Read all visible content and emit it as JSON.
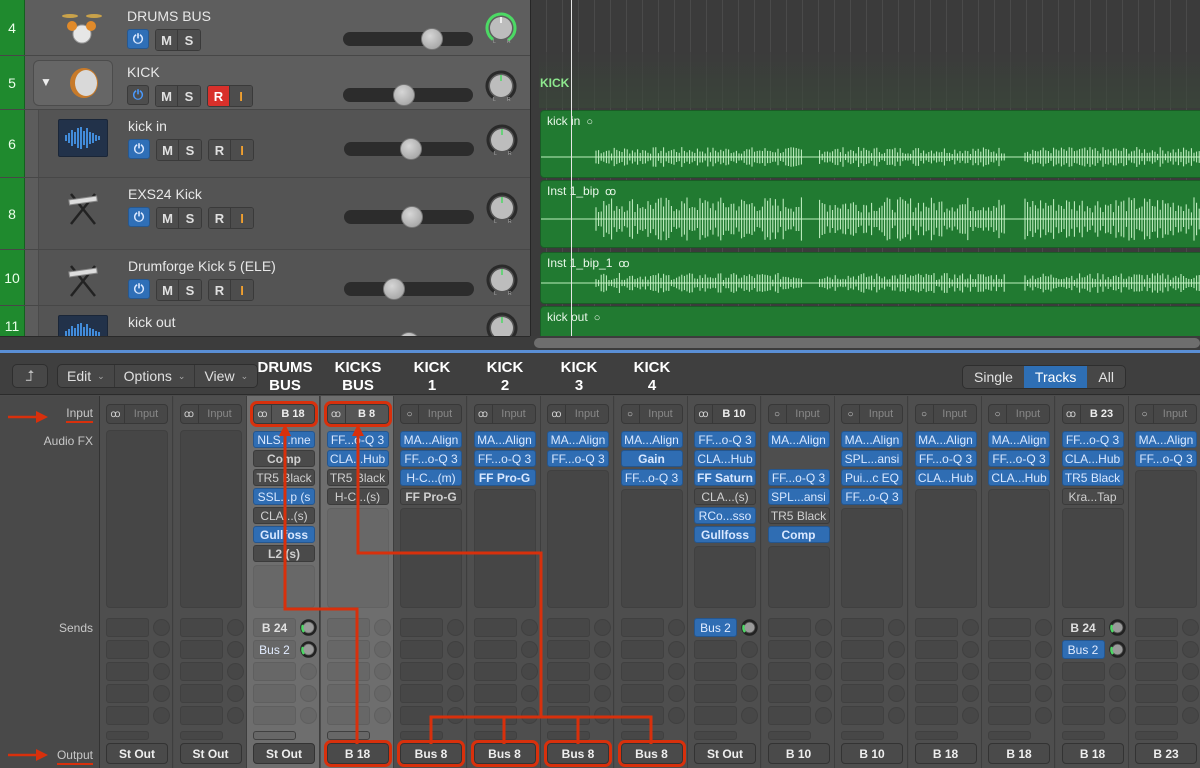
{
  "tracks": [
    {
      "number": "4",
      "name": "DRUMS BUS",
      "icon": "drum-kit-icon",
      "kind": "bus",
      "power_on": true,
      "buttons": [
        "M",
        "S"
      ],
      "record": null,
      "fader": 0.72,
      "pan_active": true
    },
    {
      "number": "5",
      "name": "KICK",
      "icon": "kick-drum-icon",
      "kind": "folder",
      "power_on": false,
      "buttons": [
        "M",
        "S"
      ],
      "record": {
        "r": "R",
        "i": "I",
        "armed": true
      },
      "fader": 0.46,
      "pan_active": false
    },
    {
      "number": "6",
      "name": "kick in",
      "icon": "audio-waveform-icon",
      "kind": "child",
      "power_on": true,
      "buttons": [
        "M",
        "S"
      ],
      "record": {
        "r": "R",
        "i": "I",
        "armed": false
      },
      "fader": 0.52,
      "pan_active": false
    },
    {
      "number": "8",
      "name": "EXS24 Kick",
      "icon": "keyboard-stand-icon",
      "kind": "child",
      "power_on": true,
      "buttons": [
        "M",
        "S"
      ],
      "record": {
        "r": "R",
        "i": "I",
        "armed": false
      },
      "fader": 0.53,
      "pan_active": false
    },
    {
      "number": "10",
      "name": "Drumforge Kick 5 (ELE)",
      "icon": "keyboard-stand-icon",
      "kind": "child",
      "power_on": true,
      "buttons": [
        "M",
        "S"
      ],
      "record": {
        "r": "R",
        "i": "I",
        "armed": false
      },
      "fader": 0.36,
      "pan_active": false
    },
    {
      "number": "11",
      "name": "kick out",
      "icon": "audio-waveform-icon",
      "kind": "child",
      "power_on": true,
      "buttons": [
        "M",
        "S"
      ],
      "record": null,
      "fader": 0.5,
      "pan_active": false
    }
  ],
  "arrange": {
    "folder_label": "KICK",
    "regions": [
      {
        "name": "kick in",
        "loop_icon": "○",
        "channels": "mono"
      },
      {
        "name": "Inst 1_bip",
        "loop_icon": "ꝏ",
        "channels": "stereo"
      },
      {
        "name": "Inst 1_bip_1",
        "loop_icon": "ꝏ",
        "channels": "stereo"
      },
      {
        "name": "kick out",
        "loop_icon": "○",
        "channels": "mono"
      }
    ]
  },
  "mixer": {
    "toolbar": {
      "back_icon": "⮥",
      "menus": [
        "Edit",
        "Options",
        "View"
      ],
      "view_modes": [
        "Single",
        "Tracks",
        "All"
      ],
      "active_view": "Tracks"
    },
    "row_labels": {
      "input": "Input",
      "audio_fx": "Audio FX",
      "sends": "Sends",
      "output": "Output"
    },
    "annotations": [
      "DRUMS BUS",
      "KICKS BUS",
      "KICK 1",
      "KICK 2",
      "KICK 3",
      "KICK 4"
    ],
    "strips": [
      {
        "input": {
          "fmt": "ꝏ",
          "value": "Input",
          "set": false
        },
        "fx": [],
        "sends": [],
        "output": "St Out"
      },
      {
        "input": {
          "fmt": "ꝏ",
          "value": "Input",
          "set": false
        },
        "fx": [],
        "sends": [],
        "output": "St Out"
      },
      {
        "input": {
          "fmt": "ꝏ",
          "value": "B 18",
          "set": true,
          "boxed": true
        },
        "highlight": true,
        "fx": [
          {
            "n": "NLS...nne",
            "on": true
          },
          {
            "n": "Comp",
            "on": false,
            "bold": true
          },
          {
            "n": "TR5 Black",
            "on": false
          },
          {
            "n": "SSL...p (s",
            "on": true
          },
          {
            "n": "CLA...(s)",
            "on": false
          },
          {
            "n": "Gullfoss",
            "on": true,
            "bold": true
          },
          {
            "n": "L2 (s)",
            "on": false,
            "bold": true
          }
        ],
        "sends": [
          {
            "n": "B 24",
            "on": false
          },
          {
            "n": "Bus 2",
            "on": true
          }
        ],
        "output": "St Out"
      },
      {
        "input": {
          "fmt": "ꝏ",
          "value": "B 8",
          "set": true,
          "boxed": true
        },
        "highlight": true,
        "fx": [
          {
            "n": "FF...o-Q 3",
            "on": true
          },
          {
            "n": "CLA...Hub",
            "on": true
          },
          {
            "n": "TR5 Black",
            "on": false
          },
          {
            "n": "H-C...(s)",
            "on": false
          }
        ],
        "sends": [],
        "output": "B 18",
        "output_boxed": true
      },
      {
        "input": {
          "fmt": "○",
          "value": "Input",
          "set": false
        },
        "fx": [
          {
            "n": "MA...Align",
            "on": true
          },
          {
            "n": "FF...o-Q 3",
            "on": true
          },
          {
            "n": "H-C...(m)",
            "on": true
          },
          {
            "n": "FF Pro-G",
            "on": false,
            "bold": true
          }
        ],
        "sends": [],
        "output": "Bus 8",
        "output_boxed": true
      },
      {
        "input": {
          "fmt": "ꝏ",
          "value": "Input",
          "set": false
        },
        "fx": [
          {
            "n": "MA...Align",
            "on": true
          },
          {
            "n": "FF...o-Q 3",
            "on": true
          },
          {
            "n": "FF Pro-G",
            "on": true,
            "bold": true
          }
        ],
        "sends": [],
        "output": "Bus 8",
        "output_boxed": true
      },
      {
        "input": {
          "fmt": "ꝏ",
          "value": "Input",
          "set": false
        },
        "fx": [
          {
            "n": "MA...Align",
            "on": true
          },
          {
            "n": "FF...o-Q 3",
            "on": true
          }
        ],
        "sends": [],
        "output": "Bus 8",
        "output_boxed": true
      },
      {
        "input": {
          "fmt": "○",
          "value": "Input",
          "set": false
        },
        "fx": [
          {
            "n": "MA...Align",
            "on": true
          },
          {
            "n": "Gain",
            "on": true,
            "bold": true
          },
          {
            "n": "FF...o-Q 3",
            "on": true
          }
        ],
        "sends": [],
        "output": "Bus 8",
        "output_boxed": true
      },
      {
        "input": {
          "fmt": "ꝏ",
          "value": "B 10",
          "set": true
        },
        "fx": [
          {
            "n": "FF...o-Q 3",
            "on": true
          },
          {
            "n": "CLA...Hub",
            "on": true
          },
          {
            "n": "FF Saturn",
            "on": true,
            "bold": true
          },
          {
            "n": "CLA...(s)",
            "on": false
          },
          {
            "n": "RCo...sso",
            "on": true
          },
          {
            "n": "Gullfoss",
            "on": true,
            "bold": true
          }
        ],
        "sends": [
          {
            "n": "Bus 2",
            "on": true
          }
        ],
        "output": "St Out"
      },
      {
        "input": {
          "fmt": "○",
          "value": "Input",
          "set": false
        },
        "fx": [
          {
            "n": "MA...Align",
            "on": true
          },
          {
            "n": "",
            "gap": true
          },
          {
            "n": "FF...o-Q 3",
            "on": true
          },
          {
            "n": "SPL...ansi",
            "on": true
          },
          {
            "n": "TR5 Black",
            "on": false
          },
          {
            "n": "Comp",
            "on": true,
            "bold": true
          }
        ],
        "sends": [],
        "output": "B 10"
      },
      {
        "input": {
          "fmt": "○",
          "value": "Input",
          "set": false
        },
        "fx": [
          {
            "n": "MA...Align",
            "on": true
          },
          {
            "n": "SPL...ansi",
            "on": true
          },
          {
            "n": "Pui...c EQ",
            "on": true
          },
          {
            "n": "FF...o-Q 3",
            "on": true
          }
        ],
        "sends": [],
        "output": "B 10"
      },
      {
        "input": {
          "fmt": "○",
          "value": "Input",
          "set": false
        },
        "fx": [
          {
            "n": "MA...Align",
            "on": true
          },
          {
            "n": "FF...o-Q 3",
            "on": true
          },
          {
            "n": "CLA...Hub",
            "on": true
          }
        ],
        "sends": [],
        "output": "B 18"
      },
      {
        "input": {
          "fmt": "○",
          "value": "Input",
          "set": false
        },
        "fx": [
          {
            "n": "MA...Align",
            "on": true
          },
          {
            "n": "FF...o-Q 3",
            "on": true
          },
          {
            "n": "CLA...Hub",
            "on": true
          }
        ],
        "sends": [],
        "output": "B 18"
      },
      {
        "input": {
          "fmt": "ꝏ",
          "value": "B 23",
          "set": true
        },
        "fx": [
          {
            "n": "FF...o-Q 3",
            "on": true
          },
          {
            "n": "CLA...Hub",
            "on": true
          },
          {
            "n": "TR5 Black",
            "on": true
          },
          {
            "n": "Kra...Tap",
            "on": false
          }
        ],
        "sends": [
          {
            "n": "B 24",
            "on": false
          },
          {
            "n": "Bus 2",
            "on": true
          }
        ],
        "output": "B 18"
      },
      {
        "input": {
          "fmt": "○",
          "value": "Input",
          "set": false
        },
        "fx": [
          {
            "n": "MA...Align",
            "on": true
          },
          {
            "n": "FF...o-Q 3",
            "on": true
          }
        ],
        "sends": [],
        "output": "B 23"
      }
    ]
  },
  "colors": {
    "region_green": "#217a31",
    "track_number_green": "#1f8a2e",
    "accent_blue": "#2f6db3",
    "routing_red": "#d8300c",
    "record_red": "#d8302b"
  }
}
